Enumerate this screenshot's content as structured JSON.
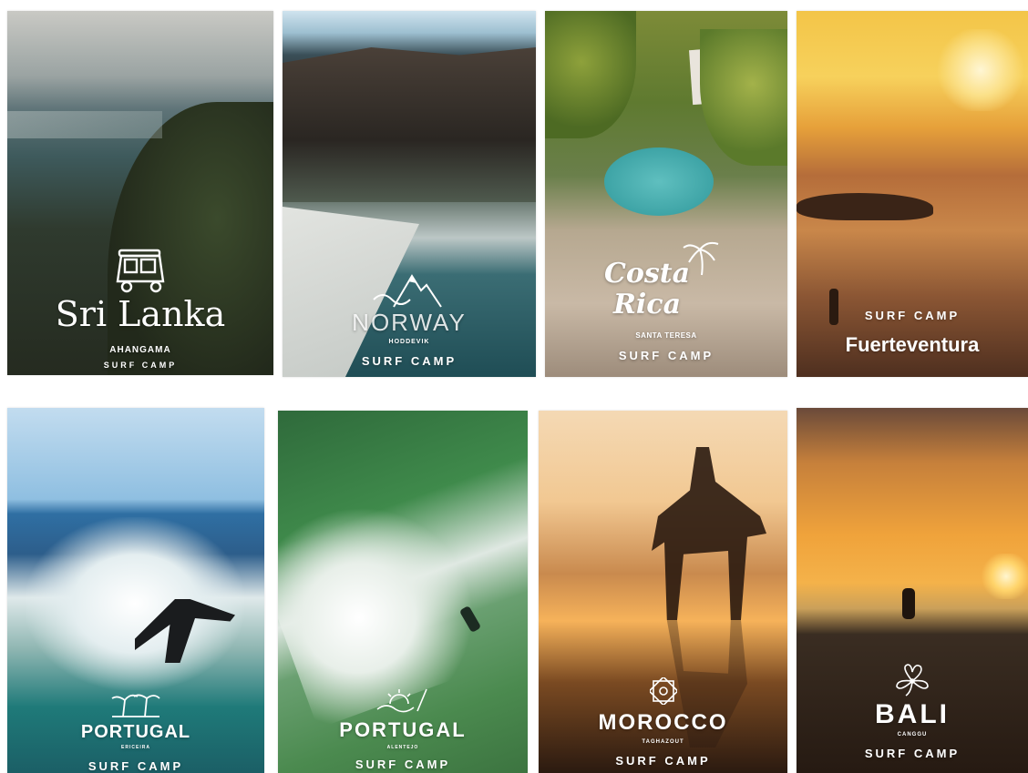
{
  "cards": [
    {
      "name": "SRI LANKA",
      "script_name": "Sri Lanka",
      "location": "AHANGAMA",
      "tagline": "SURF CAMP"
    },
    {
      "name": "NORWAY",
      "location": "HODDEVIK",
      "tagline": "SURF CAMP"
    },
    {
      "name": "Costa Rica",
      "location": "SANTA TERESA",
      "tagline": "SURF CAMP"
    },
    {
      "name": "Fuerteventura",
      "tagline": "SURF CAMP"
    },
    {
      "name": "PORTUGAL",
      "location": "ERICEIRA",
      "tagline": "SURF CAMP"
    },
    {
      "name": "PORTUGAL",
      "location": "ALENTEJO",
      "tagline": "SURF CAMP"
    },
    {
      "name": "MOROCCO",
      "location": "TAGHAZOUT",
      "tagline": "SURF CAMP"
    },
    {
      "name": "BALI",
      "location": "CANGGU",
      "tagline": "SURF CAMP"
    }
  ],
  "colors": {
    "text": "#ffffff",
    "background": "#ffffff"
  }
}
